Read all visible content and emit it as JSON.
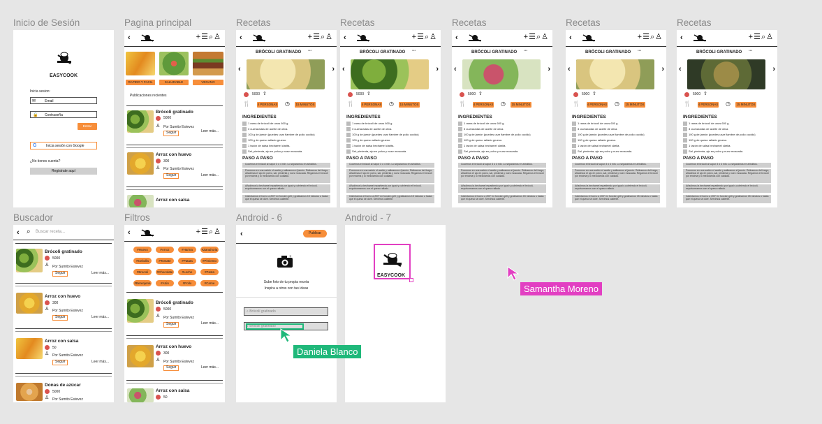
{
  "frames": {
    "login": "Inicio de Sesión",
    "home": "Pagina principal",
    "recipe": "Recetas",
    "search": "Buscador",
    "filters": "Filtros",
    "android6": "Android - 6",
    "android7": "Android - 7"
  },
  "brand": "EASYCOOK",
  "login": {
    "prompt": "Inicia sesion:",
    "email_label": "Email",
    "password_label": "Contraseña",
    "enter": "Entrar",
    "google": "Inicia sesión con Google",
    "no_account": "¿No tienes cuenta?",
    "register": "Registrate aquí"
  },
  "home": {
    "categories": [
      "RAPIDO Y FACIL",
      "SALUDABLE",
      "VEGANO"
    ],
    "recent": "Publicaciones recientes",
    "posts": [
      {
        "title": "Brócoli gratinado",
        "likes": "5000",
        "author": "Por Sumito Estevez",
        "follow": "Seguir",
        "more": "Leer más..."
      },
      {
        "title": "Arroz con huevo",
        "likes": "300",
        "author": "Por Sumito Estevez",
        "follow": "Seguir",
        "more": "Leer más..."
      },
      {
        "title": "Arroz con salsa"
      }
    ]
  },
  "recipe": {
    "title": "BRÓCOLI GRATINADO",
    "dots": "•••",
    "likes": "5000",
    "servings": "4 PERSONAS",
    "time": "15 MINUTOS",
    "ingredients_title": "INGREDIENTES",
    "ingredients": [
      "1 rama de brócoli de unos 600 g.",
      "3 cucharadas de aceite de oliva.",
      "100 g de jamón (puedes usar fiambre de pollo cocido)",
      "100 g de queso rallado grueso.",
      "1 tazón de salsa bechamel clarita.",
      "Sal, pimienta, ajo en polvo y nuez moscada."
    ],
    "steps_title": "PASO A PASO",
    "steps": [
      "Cocemos el brócoli al vapor 3 ó 4 min. Lo separamos en arbolitos.",
      "Ponemos en una sartén el aceite y salteamos el jamón. Retiramos del fuego, añadimos el ajo en polvo, sal, pimienta y nuez moscada. Regamos el brócoli por encima y lo mezclamos con cuidado.",
      "Añadimos la bechamel repartiendo por igual y cubriendo el brócoli, espolvoreamos con el queso rallado.",
      "Calentamos el horno a 200º en función grill y gratinamos 15 minutos o hasta que el queso se dore. Servimos caliente."
    ]
  },
  "search": {
    "placeholder": "Buscar receta...",
    "results": [
      {
        "title": "Brócoli gratinado",
        "likes": "5000",
        "author": "Por Sumito Estevez",
        "follow": "Seguir",
        "more": "Leer más..."
      },
      {
        "title": "Arroz con huevo",
        "likes": "300",
        "author": "Por Sumito Estevez",
        "follow": "Seguir",
        "more": "Leer más..."
      },
      {
        "title": "Arroz con salsa",
        "likes": "50",
        "author": "Por Sumito Estevez",
        "follow": "Seguir",
        "more": "Leer más..."
      },
      {
        "title": "Donas de azúcar",
        "likes": "5000",
        "author": "Por Sumito Estevez"
      }
    ]
  },
  "filters": {
    "tags": [
      "#Huevo",
      "#Arroz",
      "#Harina",
      "#Zanahoria",
      "#Cebolla",
      "#Tomate",
      "#Patata",
      "#Pimiento",
      "#Brocoli",
      "#Chocolate",
      "#Leche",
      "#Pasta",
      "#Berenjena",
      "#Atún",
      "#Pollo",
      "#Carne"
    ]
  },
  "android6": {
    "publish": "Publicar",
    "upload_line1": "Sube foto de tu propia receta",
    "upload_line2": "Inspira a otros con tus ideas",
    "field1": "Brócoli gratinado",
    "field2": "Brócoli gratinado"
  },
  "collaborators": [
    {
      "name": "Samantha Moreno",
      "color": "#e23fc2"
    },
    {
      "name": "Daniela Blanco",
      "color": "#1fb87a"
    }
  ]
}
